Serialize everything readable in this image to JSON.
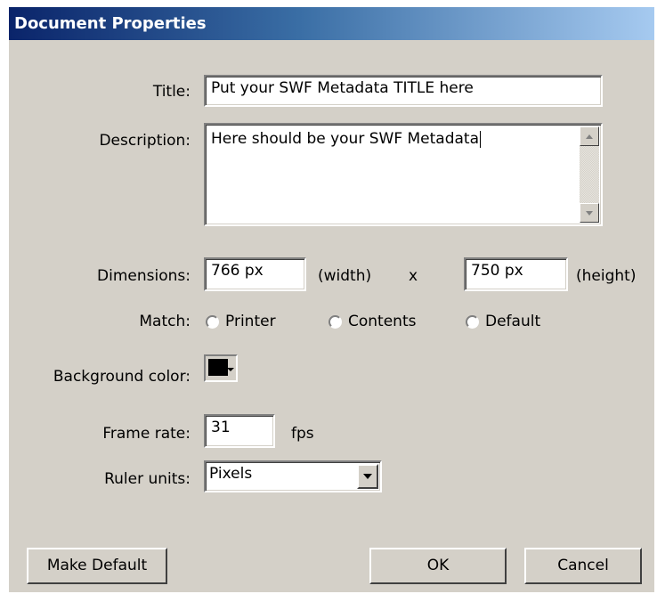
{
  "window": {
    "title": "Document Properties"
  },
  "form": {
    "title": {
      "label": "Title:",
      "value": "Put your SWF Metadata TITLE here"
    },
    "description": {
      "label": "Description:",
      "value": "Here should be your SWF Metadata"
    },
    "dimensions": {
      "label": "Dimensions:",
      "width_value": "766 px",
      "width_label": "(width)",
      "separator": "x",
      "height_value": "750 px",
      "height_label": "(height)"
    },
    "match": {
      "label": "Match:",
      "options": [
        "Printer",
        "Contents",
        "Default"
      ]
    },
    "background_color": {
      "label": "Background color:",
      "color": "#000000"
    },
    "frame_rate": {
      "label": "Frame rate:",
      "value": "31",
      "unit": "fps"
    },
    "ruler_units": {
      "label": "Ruler units:",
      "value": "Pixels"
    }
  },
  "buttons": {
    "make_default": "Make Default",
    "ok": "OK",
    "cancel": "Cancel"
  },
  "colors": {
    "dialog_bg": "#d4d0c8",
    "titlebar_start": "#0a246a",
    "titlebar_end": "#a6caf0"
  }
}
